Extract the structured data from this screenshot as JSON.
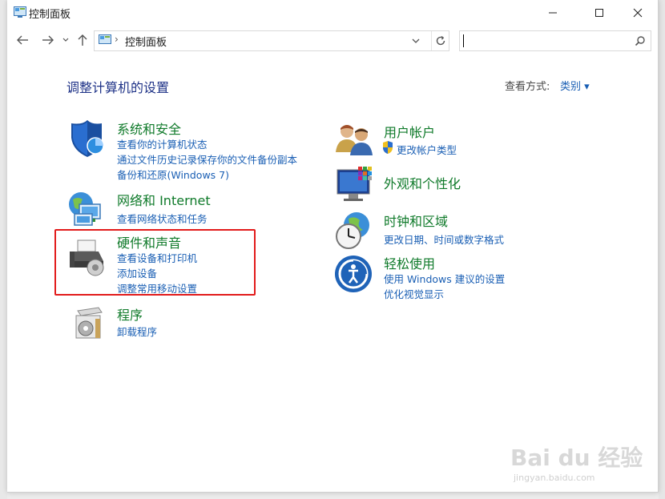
{
  "window": {
    "title": "控制面板"
  },
  "address": {
    "path": "控制面板",
    "separator": "›"
  },
  "search": {
    "placeholder": ""
  },
  "heading": "调整计算机的设置",
  "view_by": {
    "label": "查看方式:",
    "value": "类别 ▾"
  },
  "categories_left": [
    {
      "title": "系统和安全",
      "links": [
        "查看你的计算机状态",
        "通过文件历史记录保存你的文件备份副本",
        "备份和还原(Windows 7)"
      ]
    },
    {
      "title": "网络和 Internet",
      "links": [
        "查看网络状态和任务"
      ]
    },
    {
      "title": "硬件和声音",
      "links": [
        "查看设备和打印机",
        "添加设备",
        "调整常用移动设置"
      ]
    },
    {
      "title": "程序",
      "links": [
        "卸载程序"
      ]
    }
  ],
  "categories_right": [
    {
      "title": "用户帐户",
      "links": [
        "更改帐户类型"
      ]
    },
    {
      "title": "外观和个性化",
      "links": []
    },
    {
      "title": "时钟和区域",
      "links": [
        "更改日期、时间或数字格式"
      ]
    },
    {
      "title": "轻松使用",
      "links": [
        "使用 Windows 建议的设置",
        "优化视觉显示"
      ]
    }
  ],
  "watermark": {
    "brand": "Bai du 经验",
    "url": "jingyan.baidu.com"
  },
  "colors": {
    "heading": "#1e3287",
    "category": "#0f7a2a",
    "link": "#1a5fb4",
    "highlight": "#e21b1b"
  }
}
